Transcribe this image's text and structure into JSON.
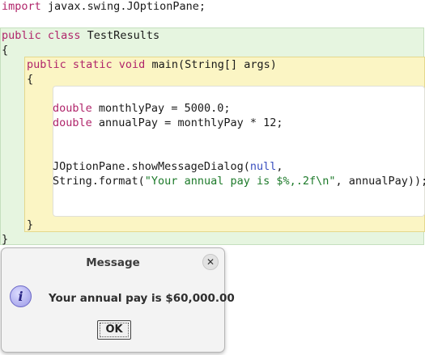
{
  "code": {
    "line1": {
      "kw": "import",
      "rest": " javax.swing.JOptionPane;"
    },
    "line2": {
      "kw": "public class",
      "rest": " TestResults"
    },
    "line3": {
      "text": "{"
    },
    "line4": {
      "kw": "public static void",
      "rest": " main(String[] args)"
    },
    "line5": {
      "text": "{"
    },
    "line6": {
      "kw": "double",
      "rest": " monthlyPay = 5000.0;"
    },
    "line7": {
      "kw": "double",
      "rest": " annualPay = monthlyPay * 12;"
    },
    "line8": {
      "pre": "JOptionPane.showMessageDialog(",
      "nul": "null",
      "post": ","
    },
    "line9": {
      "pre": "String.format(",
      "str": "\"Your annual pay is $%,.2f\\n\"",
      "post": ", annualPay));"
    },
    "line10": {
      "text": "}"
    },
    "line11": {
      "text": "}"
    }
  },
  "dialog": {
    "title": "Message",
    "close_glyph": "✕",
    "icon_glyph": "i",
    "message": "Your annual pay is $60,000.00",
    "ok_label": "OK"
  }
}
